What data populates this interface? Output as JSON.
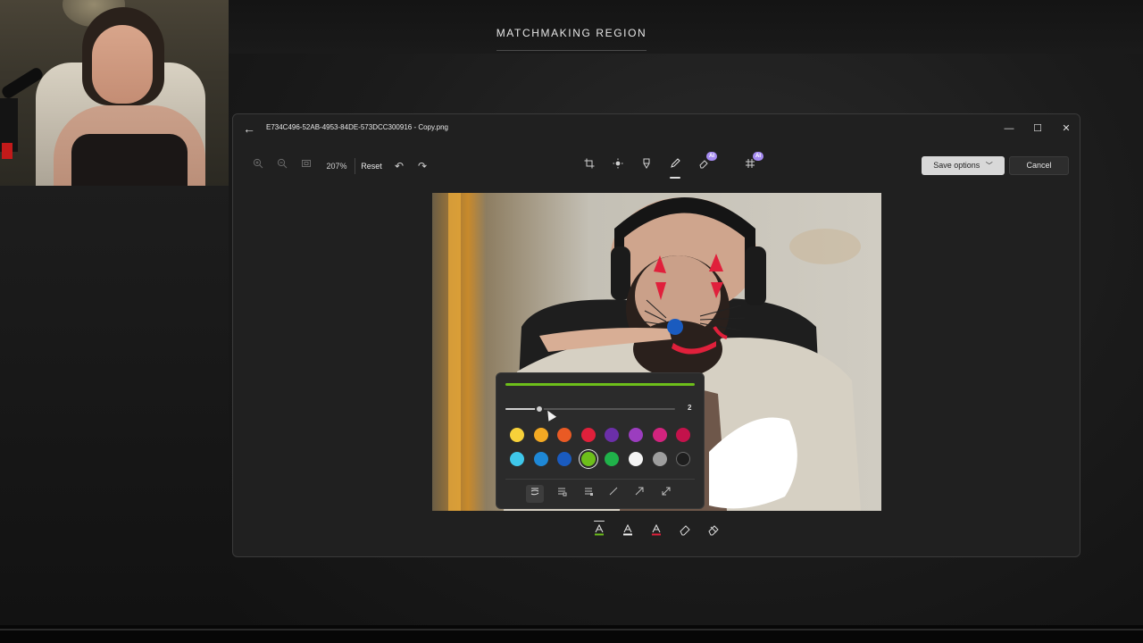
{
  "background": {
    "region_title": "MATCHMAKING REGION"
  },
  "window": {
    "file_name": "E734C496-52AB-4953-84DE-573DCC300916 - Copy.png",
    "back_icon": "arrow-left-icon",
    "controls": [
      "minimize-icon",
      "maximize-icon",
      "close-icon"
    ]
  },
  "toolbar": {
    "zoom_value": "207%",
    "reset_label": "Reset",
    "ai_badge": "AI",
    "save_options_label": "Save options",
    "cancel_label": "Cancel",
    "tools": [
      "crop-icon",
      "brightness-icon",
      "markup-icon",
      "draw-icon",
      "erase-ai-icon",
      "background-ai-icon"
    ],
    "active_tool": "draw-icon"
  },
  "pen_options": {
    "preview_color": "#6dbf1a",
    "size_value": "2",
    "size_fraction": 0.2,
    "colors_row1": [
      "#f7d13a",
      "#f3a923",
      "#e95a24",
      "#e0203b",
      "#6b2fa8",
      "#9b3dbf",
      "#d2247e",
      "#c3124b"
    ],
    "colors_row2": [
      "#3fc7ea",
      "#1e88d6",
      "#1a5bbf",
      "#6dbf1a",
      "#20b24a",
      "#f4f4f4",
      "#9e9e9e",
      "#1e1e1e"
    ],
    "selected_color": "#6dbf1a",
    "pen_types": [
      "pen-icon",
      "calligraphy-pen-icon",
      "highlighter-icon",
      "line-icon",
      "arrow-icon",
      "double-arrow-icon"
    ],
    "selected_pen": "pen-icon"
  },
  "draw_tools": {
    "items": [
      {
        "icon": "pen-1-icon",
        "color": "#6dbf1a"
      },
      {
        "icon": "pen-2-icon",
        "color": "#f4f4f4"
      },
      {
        "icon": "pen-3-icon",
        "color": "#e0203b"
      },
      {
        "icon": "eraser-icon",
        "color": ""
      },
      {
        "icon": "clear-all-icon",
        "color": ""
      }
    ]
  }
}
